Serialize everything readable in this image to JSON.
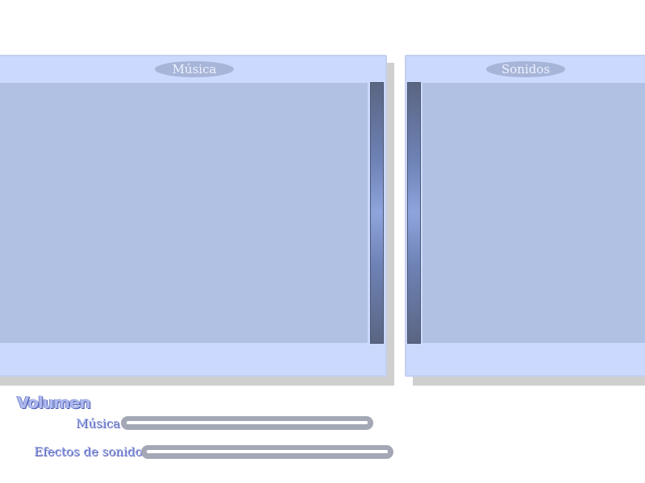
{
  "panels": {
    "music": {
      "title": "Música"
    },
    "sounds": {
      "title": "Sonidos"
    }
  },
  "volume": {
    "heading": "Volumen",
    "music_label": "Música",
    "sfx_label": "Efectos de sonido",
    "music_level": 1.0,
    "sfx_level": 1.0
  },
  "colors": {
    "panel_bg": "#cbd9ff",
    "list_bg": "#b1c1e3",
    "scrollbar_mid": "#8ea4dc",
    "slider_bg": "#a4a7b5",
    "heading_text": "#aeb9ee"
  }
}
